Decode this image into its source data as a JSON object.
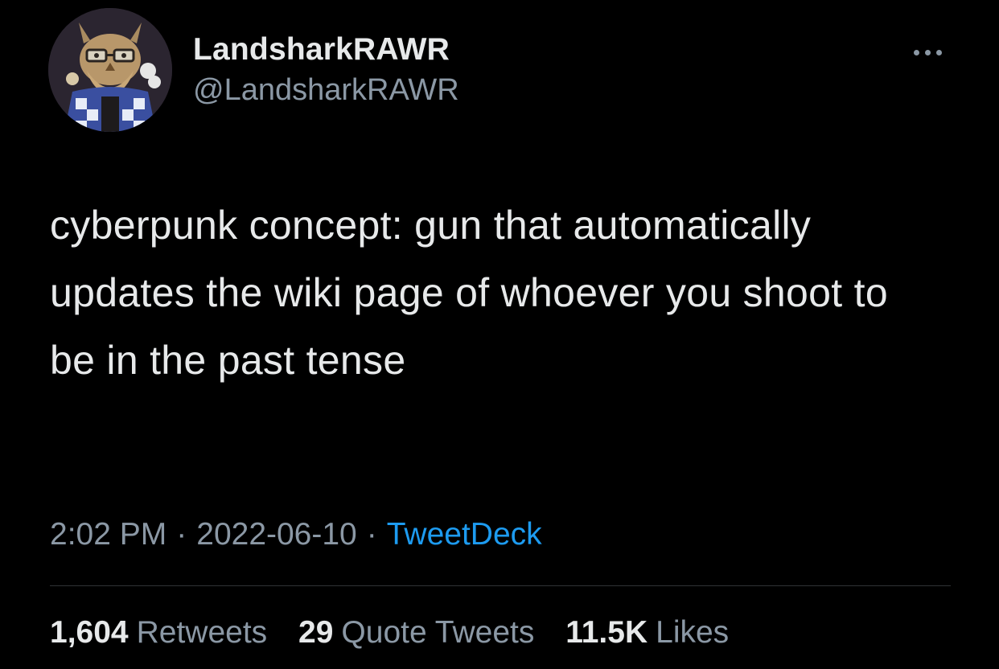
{
  "author": {
    "display_name": "LandsharkRAWR",
    "handle": "@LandsharkRAWR",
    "avatar_icon": "pixel-owl-avatar-icon"
  },
  "tweet": {
    "text": "cyberpunk concept: gun that automatically updates the wiki page of whoever you shoot to be in the past tense",
    "time": "2:02 PM",
    "date": "2022-06-10",
    "separator": "·",
    "source": "TweetDeck"
  },
  "stats": {
    "retweets_count": "1,604",
    "retweets_label": "Retweets",
    "quotes_count": "29",
    "quotes_label": "Quote Tweets",
    "likes_count": "11.5K",
    "likes_label": "Likes"
  },
  "colors": {
    "background": "#000000",
    "primary_text": "#e7e9ea",
    "secondary_text": "#8b98a5",
    "link": "#1d9bf0",
    "divider": "#2f3336"
  }
}
